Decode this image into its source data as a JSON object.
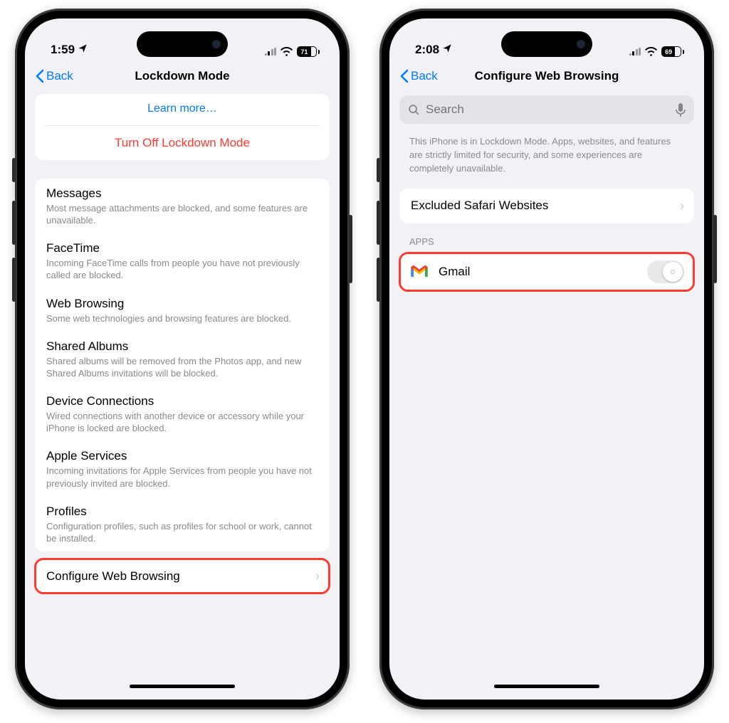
{
  "screens": [
    {
      "status": {
        "time": "1:59",
        "battery": "71"
      },
      "nav": {
        "back": "Back",
        "title": "Lockdown Mode"
      },
      "learn_more": "Learn more…",
      "turn_off": "Turn Off Lockdown Mode",
      "features": [
        {
          "title": "Messages",
          "desc": "Most message attachments are blocked, and some features are unavailable."
        },
        {
          "title": "FaceTime",
          "desc": "Incoming FaceTime calls from people you have not previously called are blocked."
        },
        {
          "title": "Web Browsing",
          "desc": "Some web technologies and browsing features are blocked."
        },
        {
          "title": "Shared Albums",
          "desc": "Shared albums will be removed from the Photos app, and new Shared Albums invitations will be blocked."
        },
        {
          "title": "Device Connections",
          "desc": "Wired connections with another device or accessory while your iPhone is locked are blocked."
        },
        {
          "title": "Apple Services",
          "desc": "Incoming invitations for Apple Services from people you have not previously invited are blocked."
        },
        {
          "title": "Profiles",
          "desc": "Configuration profiles, such as profiles for school or work, cannot be installed."
        }
      ],
      "configure": "Configure Web Browsing"
    },
    {
      "status": {
        "time": "2:08",
        "battery": "69"
      },
      "nav": {
        "back": "Back",
        "title": "Configure Web Browsing"
      },
      "search_placeholder": "Search",
      "info": "This iPhone is in Lockdown Mode. Apps, websites, and features are strictly limited for security, and some experiences are completely unavailable.",
      "excluded": "Excluded Safari Websites",
      "apps_header": "APPS",
      "app_name": "Gmail"
    }
  ]
}
